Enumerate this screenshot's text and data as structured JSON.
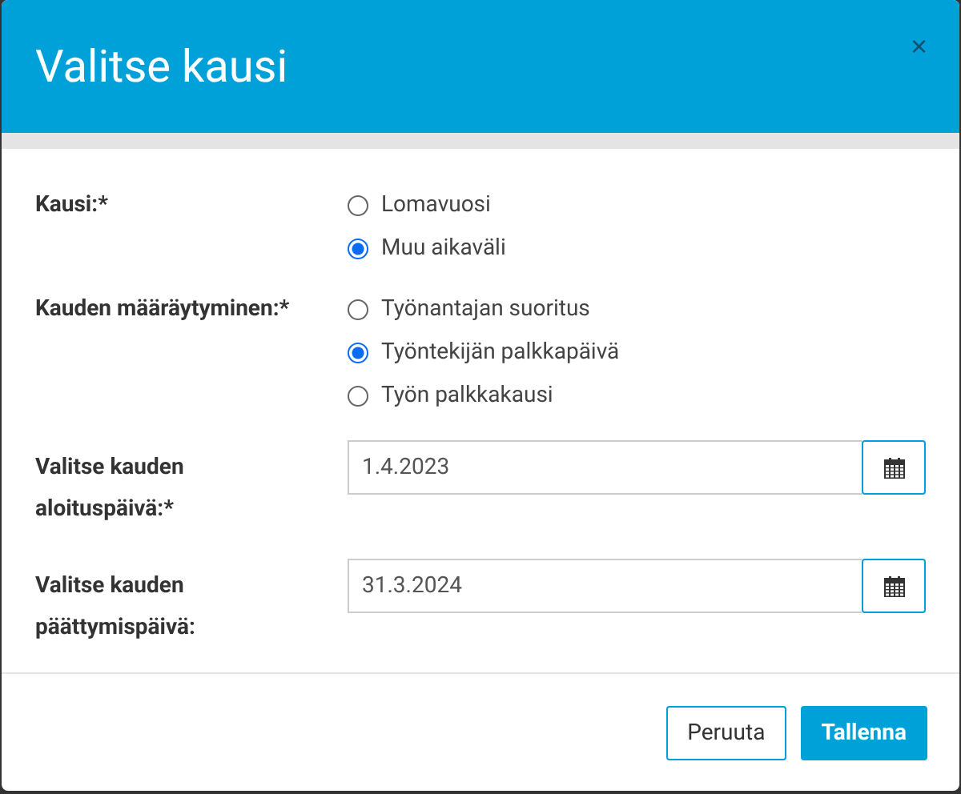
{
  "dialog": {
    "title": "Valitse kausi",
    "close": "×"
  },
  "fields": [
    {
      "kind": "radio",
      "label": "Kausi:*",
      "options": [
        {
          "label": "Lomavuosi",
          "selected": false
        },
        {
          "label": "Muu aikaväli",
          "selected": true
        }
      ]
    },
    {
      "kind": "radio",
      "label": "Kauden määräytyminen:*",
      "options": [
        {
          "label": "Työnantajan suoritus",
          "selected": false
        },
        {
          "label": "Työntekijän palkkapäivä",
          "selected": true
        },
        {
          "label": "Työn palkkakausi",
          "selected": false
        }
      ]
    },
    {
      "kind": "date",
      "label": "Valitse kauden aloituspäivä:*",
      "value": "1.4.2023"
    },
    {
      "kind": "date",
      "label": "Valitse kauden päättymispäivä:",
      "value": "31.3.2024"
    }
  ],
  "buttons": [
    {
      "label": "Peruuta",
      "kind": "secondary"
    },
    {
      "label": "Tallenna",
      "kind": "primary"
    }
  ]
}
